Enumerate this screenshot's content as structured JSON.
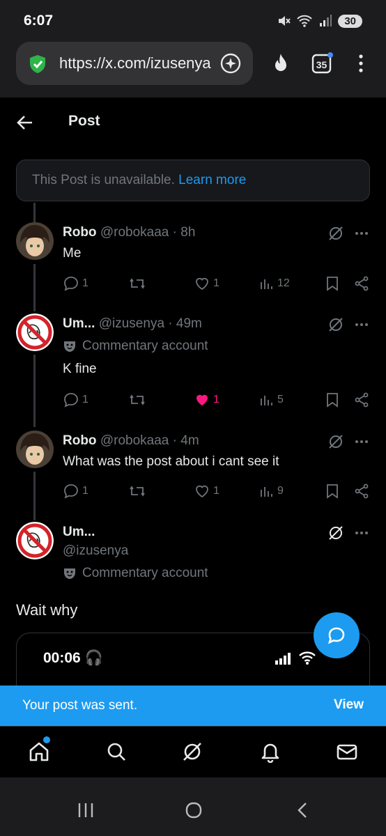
{
  "status": {
    "time": "6:07",
    "battery": "30",
    "wifi_label": "5"
  },
  "browser": {
    "url": "https://x.com/izusenya",
    "tabs_count": "35"
  },
  "header": {
    "title": "Post"
  },
  "notice": {
    "text": "This Post is unavailable.",
    "link": "Learn more"
  },
  "posts": [
    {
      "name": "Robo",
      "handle": "@robokaaa",
      "time": "· 8h",
      "text": "Me",
      "replies": "1",
      "reposts": "",
      "likes": "1",
      "views": "12",
      "liked": false
    },
    {
      "name": "Um...",
      "handle": "@izusenya",
      "time": "· 49m",
      "badge": "Commentary account",
      "text": "K fine",
      "replies": "1",
      "reposts": "",
      "likes": "1",
      "views": "5",
      "liked": true
    },
    {
      "name": "Robo",
      "handle": "@robokaaa",
      "time": "· 4m",
      "text": "What was the post about i cant see it",
      "replies": "1",
      "reposts": "",
      "likes": "1",
      "views": "9",
      "liked": false
    }
  ],
  "main_post": {
    "name": "Um...",
    "handle": "@izusenya",
    "badge": "Commentary account",
    "text": "Wait why",
    "media_time": "00:06"
  },
  "toast": {
    "message": "Your post was sent.",
    "action": "View"
  },
  "colors": {
    "accent": "#1d9bf0",
    "like": "#f91880",
    "muted": "#71767b",
    "background": "#000000"
  }
}
